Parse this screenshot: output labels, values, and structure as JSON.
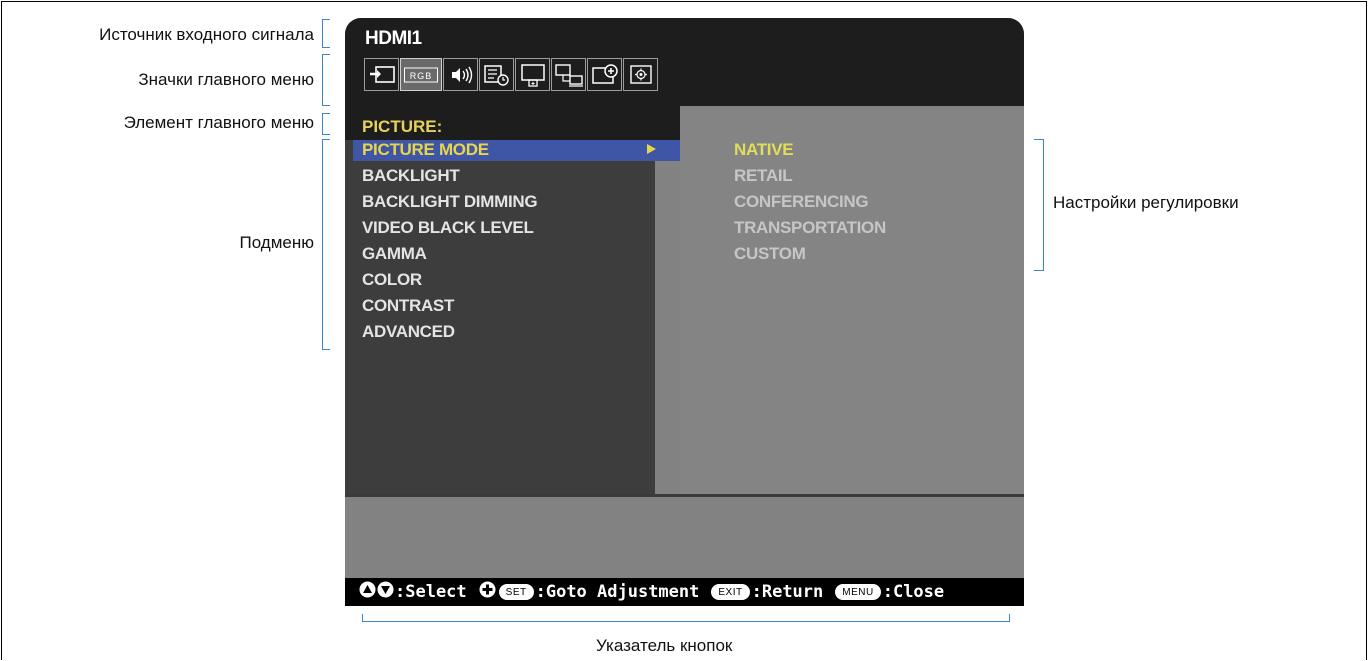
{
  "callouts": {
    "input_source": "Источник входного сигнала",
    "main_menu_icons": "Значки главного меню",
    "main_menu_item": "Элемент главного меню",
    "submenu": "Подменю",
    "adjustment_settings": "Настройки регулировки",
    "button_guide": "Указатель кнопок"
  },
  "osd": {
    "source": "HDMI1",
    "icons": [
      "input-icon",
      "rgb-icon",
      "audio-icon",
      "schedule-icon",
      "display-icon",
      "multi-input-icon",
      "protect-icon",
      "system-icon"
    ],
    "selected_icon": "rgb-icon",
    "rgb_label": "RGB",
    "category": "PICTURE:",
    "submenu": [
      "PICTURE MODE",
      "BACKLIGHT",
      "BACKLIGHT DIMMING",
      "VIDEO BLACK LEVEL",
      "GAMMA",
      "COLOR",
      "CONTRAST",
      "ADVANCED"
    ],
    "selected_submenu": "PICTURE MODE",
    "options": [
      "NATIVE",
      "RETAIL",
      "CONFERENCING",
      "TRANSPORTATION",
      "CUSTOM"
    ],
    "selected_option": "NATIVE",
    "guide": {
      "select": ":Select",
      "set_key": "SET",
      "goto": ":Goto Adjustment",
      "exit_key": "EXIT",
      "return": ":Return",
      "menu_key": "MENU",
      "close": ":Close"
    }
  },
  "colors": {
    "accent_yellow": "#e8d54a",
    "selection_blue": "#3f55a6",
    "bracket_blue": "#3a86c8"
  }
}
